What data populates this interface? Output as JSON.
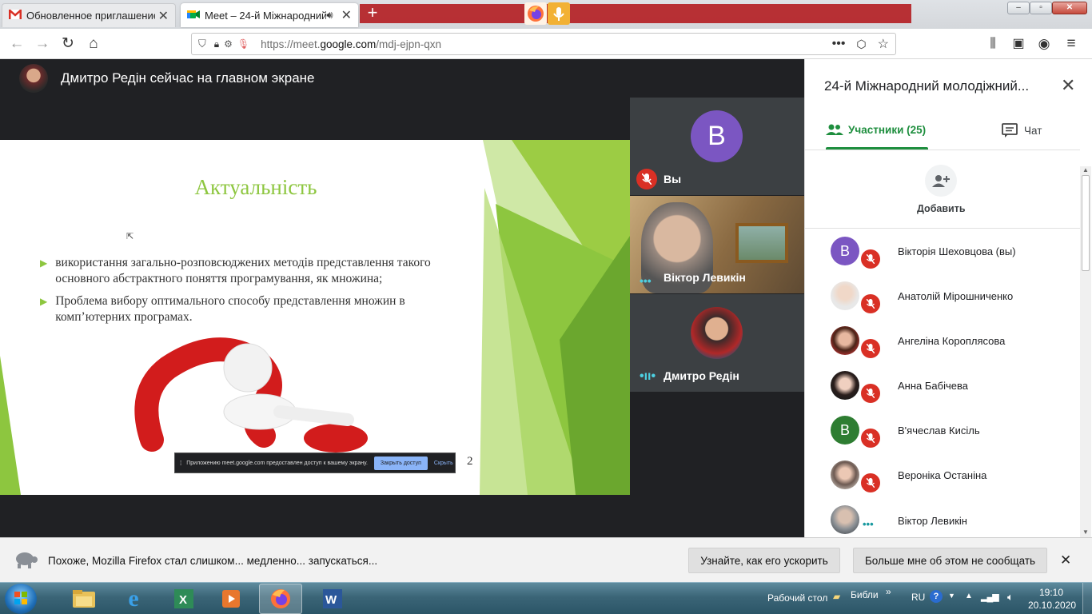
{
  "browser": {
    "tabs": [
      {
        "label": "Обновленное приглашение:",
        "active": false
      },
      {
        "label": "Meet – 24-й Міжнародний",
        "active": true
      }
    ],
    "url_prefix": "https://meet.",
    "url_host": "google.com",
    "url_path": "/mdj-ejpn-qxn"
  },
  "meet": {
    "presenter_banner": "Дмитро Редін сейчас на главном экране",
    "slide": {
      "title": "Актуальність",
      "bullets": [
        "використання загально-розповсюджених методів представлення такого основного абстрактного поняття програмування, як множина;",
        "Проблема вибору оптимального способу представлення множин в комп’ютерних програмах."
      ],
      "page_number": "2",
      "share_bar_text": "Приложению meet.google.com предоставлен доступ к вашему экрану.",
      "share_bar_button": "Закрыть доступ",
      "share_bar_hide": "Скрыть"
    },
    "tiles": [
      {
        "name": "Вы",
        "initial": "В",
        "color": "#7b56c2"
      },
      {
        "name": "Віктор Левикін"
      },
      {
        "name": "Дмитро Редін"
      }
    ]
  },
  "panel": {
    "title": "24-й Міжнародний молодіжний...",
    "tab_participants": "Участники (25)",
    "tab_chat": "Чат",
    "add_label": "Добавить",
    "participants": [
      {
        "name": "Вікторія Шеховцова (вы)",
        "initial": "В",
        "color": "#7b56c2",
        "muted": true
      },
      {
        "name": "Анатолій Мірошниченко",
        "color": "#cfcfcf",
        "muted": true
      },
      {
        "name": "Ангеліна Короплясова",
        "color": "#5a3a32",
        "muted": true
      },
      {
        "name": "Анна Бабічева",
        "color": "#3d2f2c",
        "muted": true
      },
      {
        "name": "В'ячеслав Кисіль",
        "initial": "В",
        "color": "#2e7d32",
        "muted": true
      },
      {
        "name": "Вероніка Останіна",
        "color": "#6d5a52",
        "muted": true
      },
      {
        "name": "Віктор Левикін",
        "color": "#8a8f94",
        "muted": false
      }
    ]
  },
  "notification": {
    "text": "Похоже, Mozilla Firefox стал слишком... медленно... запускаться...",
    "button1": "Узнайте, как его ускорить",
    "button2": "Больше мне об этом не сообщать"
  },
  "taskbar": {
    "desktop_label": "Рабочий стол",
    "folder_label": "Библи",
    "lang": "RU",
    "time": "19:10",
    "date": "20.10.2020"
  },
  "colors": {
    "accent": "#1e8e3e",
    "mic_off": "#d93025",
    "slide_title": "#8dc63f"
  }
}
